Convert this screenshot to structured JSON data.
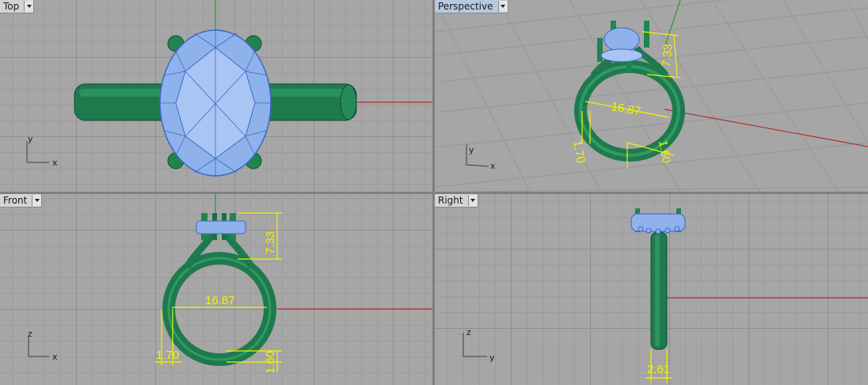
{
  "colors": {
    "viewport_bg": "#a6a6a6",
    "grid_line": "#9c9c9c",
    "x_axis": "#b03030",
    "y_axis": "#2a9a2a",
    "metal": "#1e7a4c",
    "gem": "#8fb2ec",
    "dimension": "#f2f200",
    "active_tab": "#b7c9de"
  },
  "viewports": {
    "top": {
      "title": "Top",
      "axis_x": "x",
      "axis_y": "y"
    },
    "perspective": {
      "title": "Perspective",
      "axis_x": "x",
      "axis_y": "y"
    },
    "front": {
      "title": "Front",
      "axis_x": "x",
      "axis_y": "z"
    },
    "right": {
      "title": "Right",
      "axis_x": "y",
      "axis_y": "z"
    }
  },
  "dimensions": {
    "setting_height": "7.33",
    "inner_diameter": "16.87",
    "band_thickness": "1.70",
    "band_height": "1.60",
    "band_width": "2.61"
  },
  "icons": {
    "viewport_menu": "dropdown-arrow-icon",
    "axis_widget": "axis-icon"
  }
}
